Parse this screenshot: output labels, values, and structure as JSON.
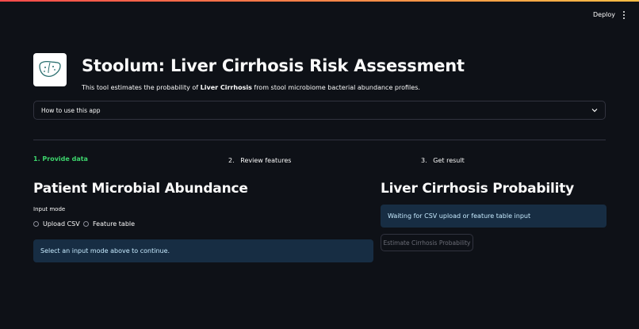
{
  "header": {
    "deploy_label": "Deploy",
    "menu_icon": "kebab-menu-icon"
  },
  "app": {
    "logo_icon": "liver-icon",
    "title": "Stoolum: Liver Cirrhosis Risk Assessment",
    "description_prefix": "This tool estimates the probability of ",
    "description_bold": "Liver Cirrhosis",
    "description_suffix": " from stool microbiome bacterial abundance profiles."
  },
  "expander": {
    "label": "How to use this app",
    "icon": "chevron-down-icon"
  },
  "steps": [
    {
      "label": "1. Provide data",
      "active": true
    },
    {
      "num": "2.",
      "label": "Review features",
      "active": false
    },
    {
      "num": "3.",
      "label": "Get result",
      "active": false
    }
  ],
  "left_panel": {
    "heading": "Patient Microbial Abundance",
    "input_mode_label": "Input mode",
    "options": [
      "Upload CSV",
      "Feature table"
    ],
    "info_message": "Select an input mode above to continue."
  },
  "right_panel": {
    "heading": "Liver Cirrhosis Probability",
    "waiting_message": "Waiting for CSV upload or feature table input",
    "estimate_button": "Estimate Cirrhosis Probability"
  },
  "colors": {
    "background": "#0e1117",
    "accent_green": "#3dd56d",
    "info_bg": "#172d43",
    "info_text": "#c7ebff"
  }
}
